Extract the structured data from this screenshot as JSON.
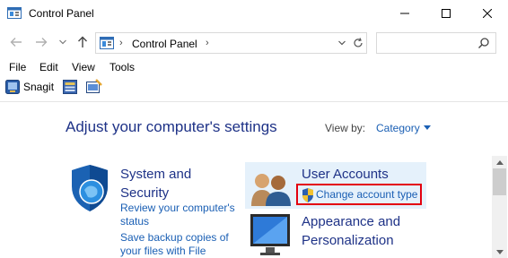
{
  "window": {
    "title": "Control Panel",
    "icon": "control-panel-icon"
  },
  "nav": {
    "back_icon": "arrow-left-icon",
    "forward_icon": "arrow-right-icon",
    "recent_icon": "chevron-down-icon",
    "up_icon": "arrow-up-icon"
  },
  "address": {
    "chevron_leading": "›",
    "path": "Control Panel",
    "chevron_trailing": "›"
  },
  "search": {
    "placeholder": ""
  },
  "menu": {
    "items": [
      "File",
      "Edit",
      "View",
      "Tools"
    ]
  },
  "toolbar": {
    "snagit_label": "Snagit"
  },
  "content": {
    "heading": "Adjust your computer's settings",
    "view_by_label": "View by:",
    "view_by_value": "Category"
  },
  "categories": {
    "system_security": {
      "title": "System and Security",
      "links": [
        "Review your computer's status",
        "Save backup copies of your files with File"
      ]
    },
    "user_accounts": {
      "title": "User Accounts",
      "link": "Change account type"
    },
    "appearance": {
      "title": "Appearance and Personalization"
    }
  },
  "colors": {
    "heading": "#1e3287",
    "link": "#1a5fb4",
    "highlight_border": "#e3000f",
    "hover_panel": "#e5f1fb"
  }
}
